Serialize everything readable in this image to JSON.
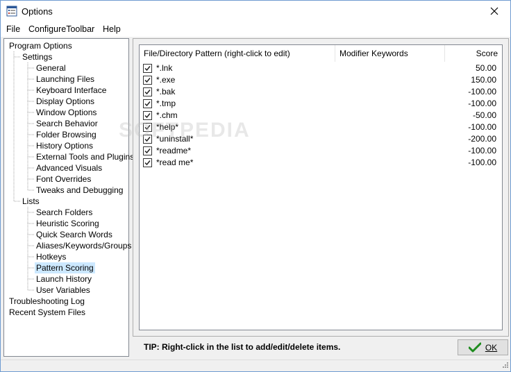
{
  "window": {
    "title": "Options"
  },
  "menu": [
    "File",
    "ConfigureToolbar",
    "Help"
  ],
  "tree": {
    "root1": "Program Options",
    "settings": "Settings",
    "settings_items": [
      "General",
      "Launching Files",
      "Keyboard Interface",
      "Display Options",
      "Window Options",
      "Search Behavior",
      "Folder Browsing",
      "History Options",
      "External Tools and Plugins",
      "Advanced Visuals",
      "Font Overrides",
      "Tweaks and Debugging"
    ],
    "lists": "Lists",
    "lists_items": [
      "Search Folders",
      "Heuristic Scoring",
      "Quick Search Words",
      "Aliases/Keywords/Groups",
      "Hotkeys",
      "Pattern Scoring",
      "Launch History",
      "User Variables"
    ],
    "selected": "Pattern Scoring",
    "root2": "Troubleshooting Log",
    "root3": "Recent System Files"
  },
  "list": {
    "columns": [
      "File/Directory Pattern (right-click to edit)",
      "Modifier Keywords",
      "Score"
    ],
    "rows": [
      {
        "pattern": "*.lnk",
        "checked": true,
        "modifier": "",
        "score": "50.00"
      },
      {
        "pattern": "*.exe",
        "checked": true,
        "modifier": "",
        "score": "150.00"
      },
      {
        "pattern": "*.bak",
        "checked": true,
        "modifier": "",
        "score": "-100.00"
      },
      {
        "pattern": "*.tmp",
        "checked": true,
        "modifier": "",
        "score": "-100.00"
      },
      {
        "pattern": "*.chm",
        "checked": true,
        "modifier": "",
        "score": "-50.00"
      },
      {
        "pattern": "*help*",
        "checked": true,
        "modifier": "",
        "score": "-100.00"
      },
      {
        "pattern": "*uninstall*",
        "checked": true,
        "modifier": "",
        "score": "-200.00"
      },
      {
        "pattern": "*readme*",
        "checked": true,
        "modifier": "",
        "score": "-100.00"
      },
      {
        "pattern": "*read me*",
        "checked": true,
        "modifier": "",
        "score": "-100.00"
      }
    ]
  },
  "watermark": "SOFTPEDIA",
  "tip": "TIP: Right-click in the list to add/edit/delete items.",
  "ok_button": {
    "label": "OK",
    "icon": "checkmark-icon"
  },
  "colors": {
    "accent_check": "#1e8c1e",
    "selection": "#cce8ff"
  }
}
